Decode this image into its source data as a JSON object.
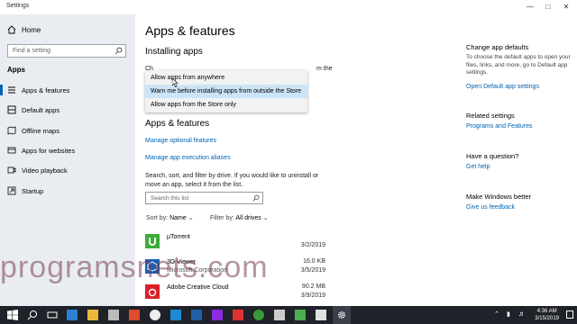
{
  "window": {
    "title": "Settings"
  },
  "sidebar": {
    "home_label": "Home",
    "search_placeholder": "Find a setting",
    "section_title": "Apps",
    "items": [
      {
        "label": "Apps & features",
        "icon": "list-icon",
        "active": true
      },
      {
        "label": "Default apps",
        "icon": "default-apps-icon",
        "active": false
      },
      {
        "label": "Offline maps",
        "icon": "map-icon",
        "active": false
      },
      {
        "label": "Apps for websites",
        "icon": "web-apps-icon",
        "active": false
      },
      {
        "label": "Video playback",
        "icon": "video-icon",
        "active": false
      },
      {
        "label": "Startup",
        "icon": "startup-icon",
        "active": false
      }
    ]
  },
  "main": {
    "title": "Apps & features",
    "installing_heading": "Installing apps",
    "installing_partial": "Ch",
    "installing_partial_end": "m the",
    "dropdown_options": [
      "Allow apps from anywhere",
      "Warn me before installing apps from outside the Store",
      "Allow apps from the Store only"
    ],
    "dropdown_selected_index": 1,
    "apps_heading": "Apps & features",
    "link_optional": "Manage optional features",
    "link_alias": "Manage app execution aliases",
    "search_desc_1": "Search, sort, and filter by drive. If you would like to uninstall or",
    "search_desc_2": "move an app, select it from the list.",
    "search_placeholder": "Search this list",
    "sort_label": "Sort by:",
    "sort_value": "Name",
    "filter_label": "Filter by:",
    "filter_value": "All drives",
    "apps": [
      {
        "name": "µTorrent",
        "size": "",
        "date": "3/2/2019",
        "icon_color": "#3cab3a"
      },
      {
        "name": "3D Viewer",
        "sub": "Microsoft Corporation",
        "size": "16.0 KB",
        "date": "3/5/2019",
        "icon_color": "#1a5fb4"
      },
      {
        "name": "Adobe Creative Cloud",
        "size": "90.2 MB",
        "date": "3/9/2019",
        "icon_color": "#da1f26"
      }
    ]
  },
  "right_panel": {
    "default_heading": "Change app defaults",
    "default_text": "To choose the default apps to open your files, links, and more, go to Default app settings.",
    "default_link": "Open Default app settings",
    "related_heading": "Related settings",
    "related_link": "Programs and Features",
    "question_heading": "Have a question?",
    "question_link": "Get help",
    "better_heading": "Make Windows better",
    "better_link": "Give us feedback"
  },
  "watermark": "programsnets.com",
  "taskbar": {
    "time": "4:36 AM",
    "date": "3/15/2019"
  },
  "colors": {
    "accent": "#0063b1",
    "sidebar_bg": "#e9edf2",
    "taskbar_bg": "#1f2228"
  }
}
